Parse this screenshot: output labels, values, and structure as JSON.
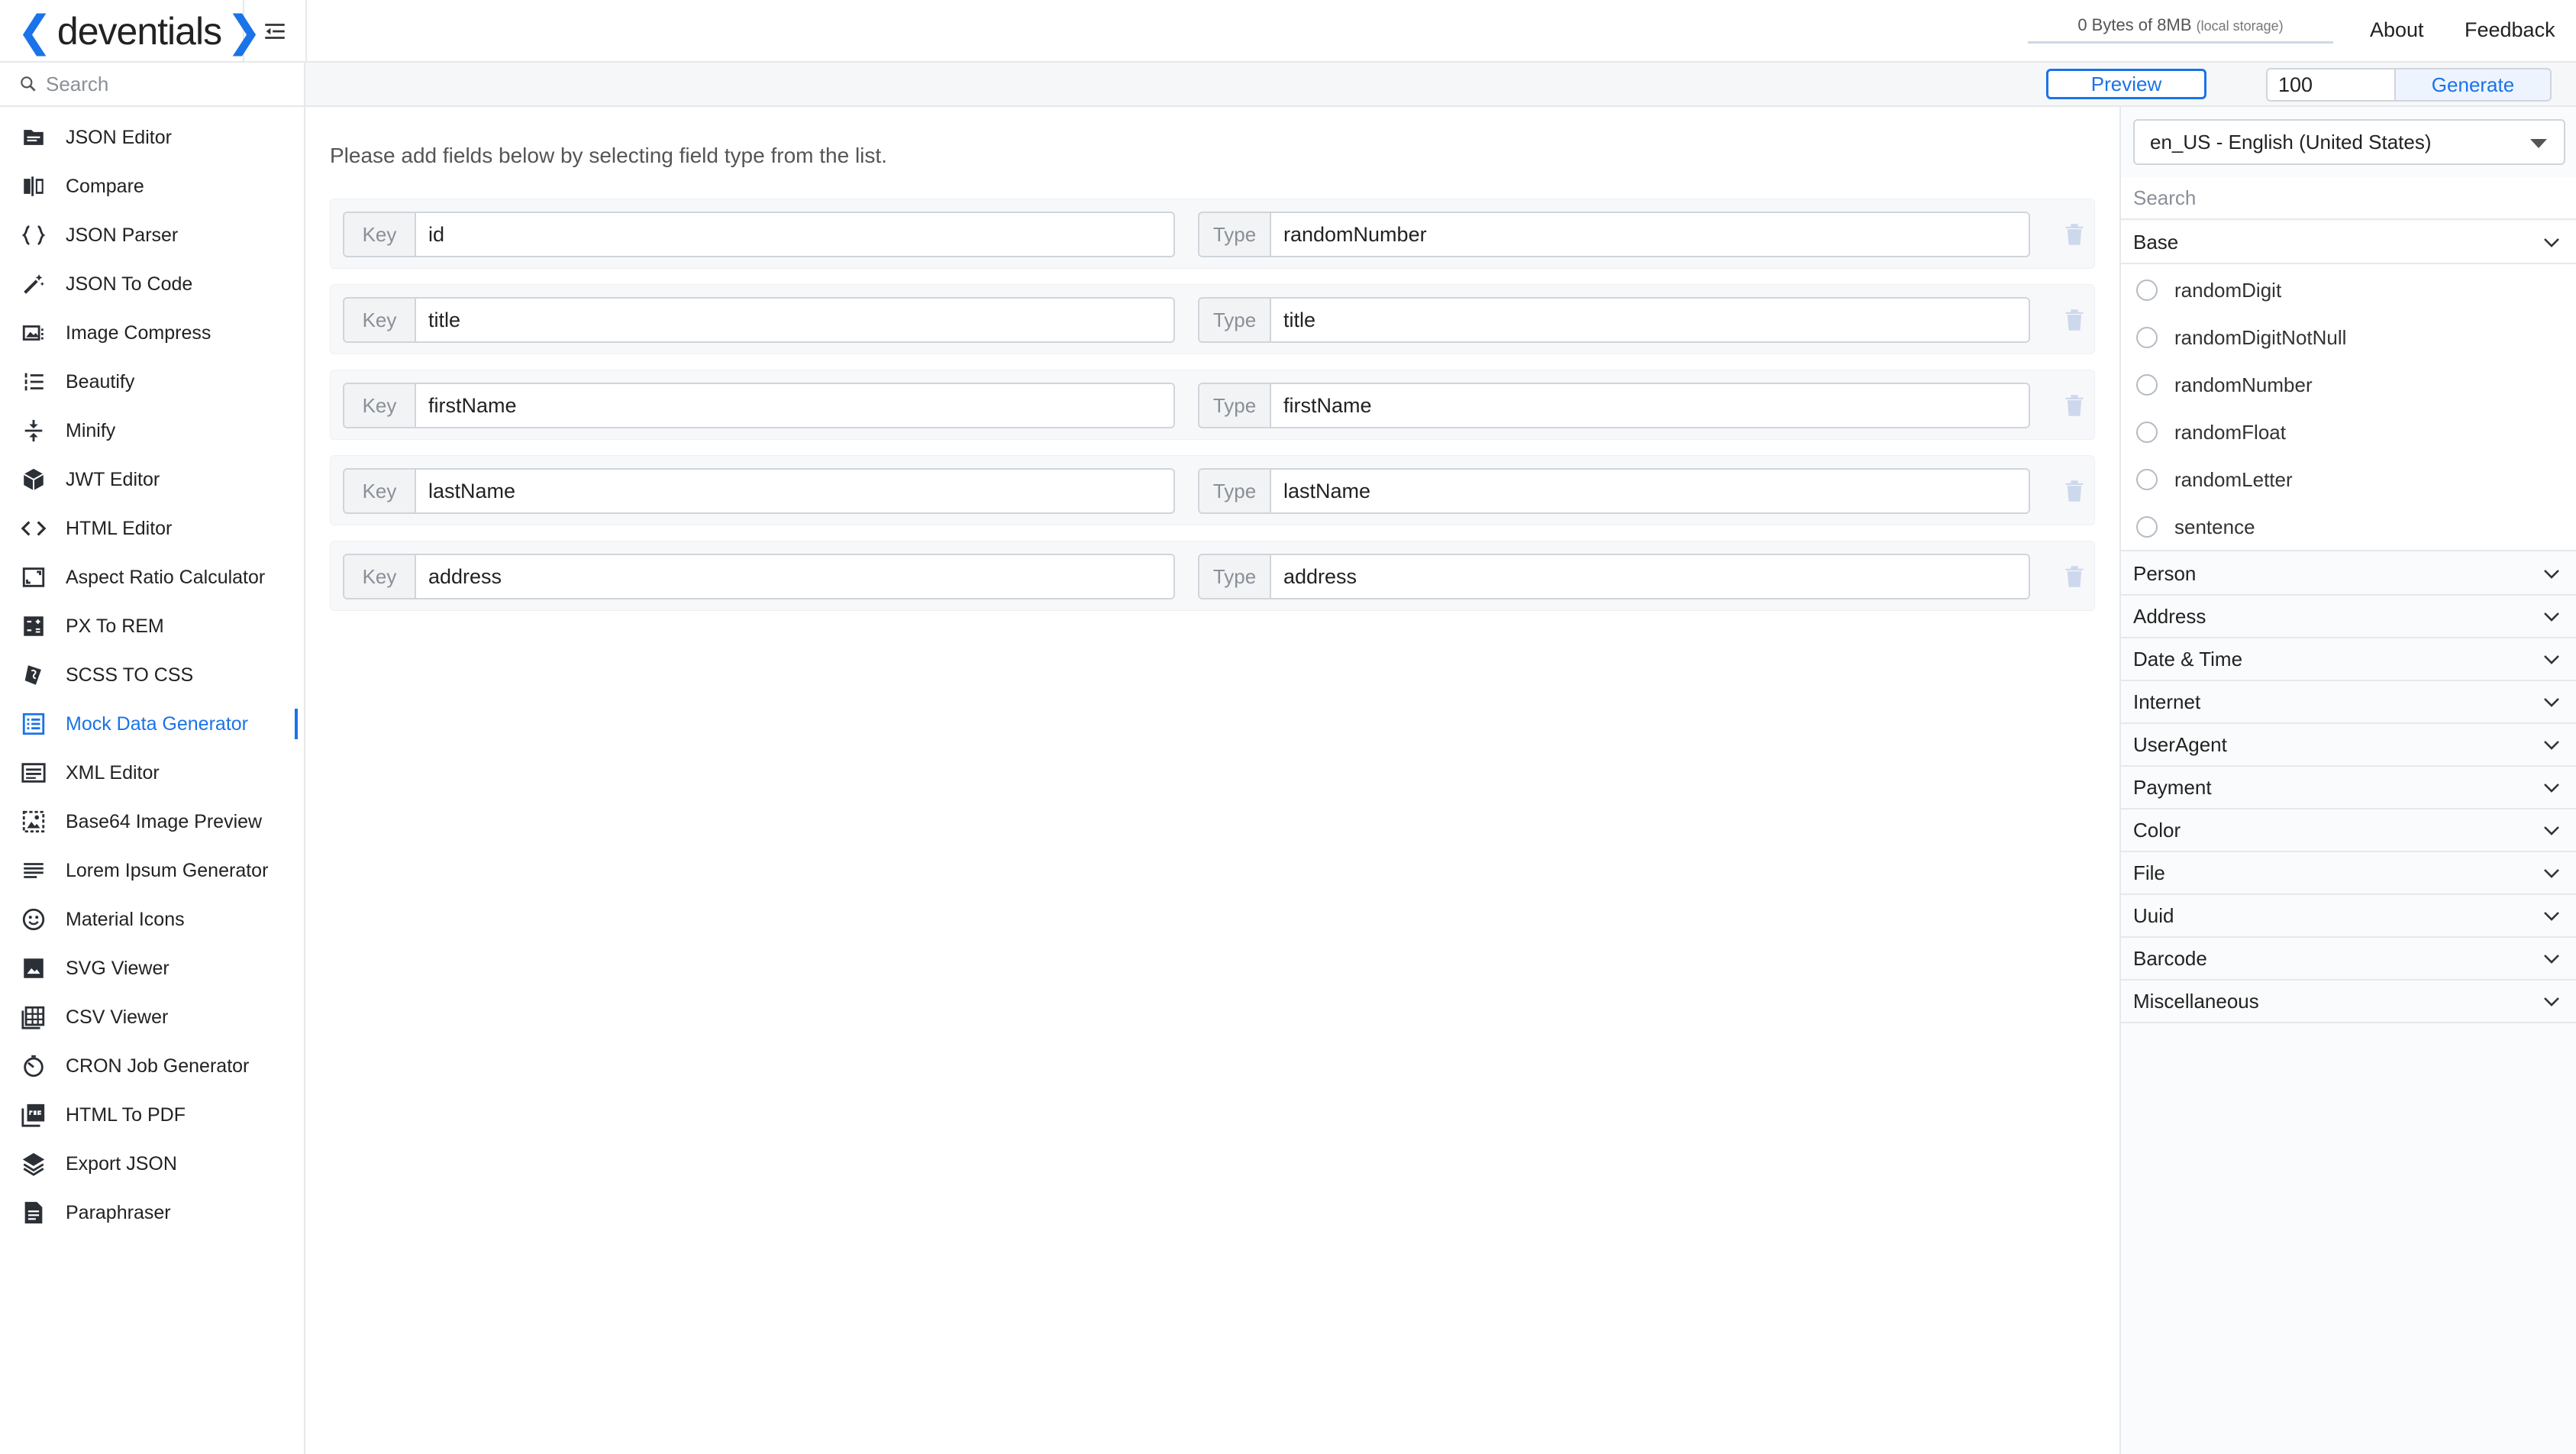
{
  "brand": {
    "name": "deventials",
    "left_chevron": "❮",
    "right_chevron": "❯"
  },
  "header": {
    "storage_text": "0 Bytes of 8MB",
    "storage_note": "(local storage)",
    "about_label": "About",
    "feedback_label": "Feedback"
  },
  "search": {
    "placeholder": "Search",
    "value": ""
  },
  "toolbar": {
    "preview_label": "Preview",
    "count_value": "100",
    "generate_label": "Generate"
  },
  "sidebar": {
    "items": [
      {
        "label": "JSON Editor",
        "icon": "folder-icon"
      },
      {
        "label": "Compare",
        "icon": "compare-icon"
      },
      {
        "label": "JSON Parser",
        "icon": "braces-icon"
      },
      {
        "label": "JSON To Code",
        "icon": "magic-wand-icon"
      },
      {
        "label": "Image Compress",
        "icon": "image-compress-icon"
      },
      {
        "label": "Beautify",
        "icon": "list-numbered-icon"
      },
      {
        "label": "Minify",
        "icon": "compress-vertical-icon"
      },
      {
        "label": "JWT Editor",
        "icon": "cube-icon"
      },
      {
        "label": "HTML Editor",
        "icon": "code-icon"
      },
      {
        "label": "Aspect Ratio Calculator",
        "icon": "aspect-ratio-icon"
      },
      {
        "label": "PX To REM",
        "icon": "calculator-icon"
      },
      {
        "label": "SCSS TO CSS",
        "icon": "sass-icon"
      },
      {
        "label": "Mock Data Generator",
        "icon": "table-list-icon",
        "active": true
      },
      {
        "label": "XML Editor",
        "icon": "xml-doc-icon"
      },
      {
        "label": "Base64 Image Preview",
        "icon": "image-preview-icon"
      },
      {
        "label": "Lorem Ipsum Generator",
        "icon": "text-lines-icon"
      },
      {
        "label": "Material Icons",
        "icon": "smiley-icon"
      },
      {
        "label": "SVG Viewer",
        "icon": "picture-icon"
      },
      {
        "label": "CSV Viewer",
        "icon": "csv-table-icon"
      },
      {
        "label": "CRON Job Generator",
        "icon": "timer-icon"
      },
      {
        "label": "HTML To PDF",
        "icon": "pdf-icon"
      },
      {
        "label": "Export JSON",
        "icon": "layers-icon"
      },
      {
        "label": "Paraphraser",
        "icon": "document-icon"
      }
    ]
  },
  "main": {
    "hint": "Please add fields below by selecting field type from the list.",
    "key_addon": "Key",
    "type_addon": "Type",
    "fields": [
      {
        "key": "id",
        "type": "randomNumber"
      },
      {
        "key": "title",
        "type": "title"
      },
      {
        "key": "firstName",
        "type": "firstName"
      },
      {
        "key": "lastName",
        "type": "lastName"
      },
      {
        "key": "address",
        "type": "address"
      }
    ]
  },
  "right_panel": {
    "locale": "en_US - English (United States)",
    "search_placeholder": "Search",
    "base": {
      "label": "Base",
      "options": [
        "randomDigit",
        "randomDigitNotNull",
        "randomNumber",
        "randomFloat",
        "randomLetter",
        "sentence"
      ]
    },
    "categories": [
      "Person",
      "Address",
      "Date & Time",
      "Internet",
      "UserAgent",
      "Payment",
      "Color",
      "File",
      "Uuid",
      "Barcode",
      "Miscellaneous"
    ]
  },
  "colors": {
    "accent": "#1a73e8",
    "border": "#d0d5dc",
    "muted_text": "#8a8f98"
  }
}
